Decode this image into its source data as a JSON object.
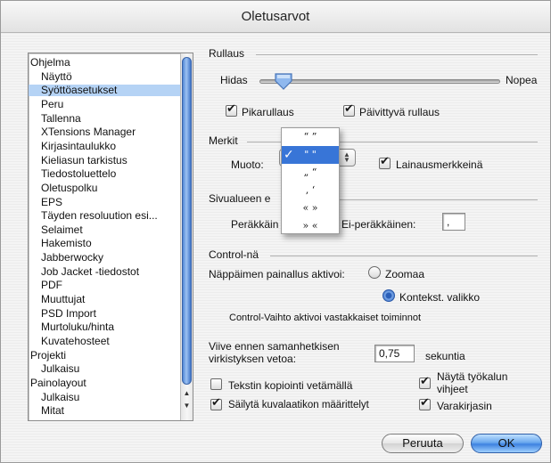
{
  "window": {
    "title": "Oletusarvot"
  },
  "list": {
    "items": [
      {
        "label": "Ohjelma",
        "indent": 0,
        "selected": false
      },
      {
        "label": "Näyttö",
        "indent": 1,
        "selected": false
      },
      {
        "label": "Syöttöasetukset",
        "indent": 1,
        "selected": true
      },
      {
        "label": "Peru",
        "indent": 1,
        "selected": false
      },
      {
        "label": "Tallenna",
        "indent": 1,
        "selected": false
      },
      {
        "label": "XTensions Manager",
        "indent": 1,
        "selected": false
      },
      {
        "label": "Kirjasintaulukko",
        "indent": 1,
        "selected": false
      },
      {
        "label": "Kieliasun tarkistus",
        "indent": 1,
        "selected": false
      },
      {
        "label": "Tiedostoluettelo",
        "indent": 1,
        "selected": false
      },
      {
        "label": "Oletuspolku",
        "indent": 1,
        "selected": false
      },
      {
        "label": "EPS",
        "indent": 1,
        "selected": false
      },
      {
        "label": "Täyden resoluution esi...",
        "indent": 1,
        "selected": false
      },
      {
        "label": "Selaimet",
        "indent": 1,
        "selected": false
      },
      {
        "label": "Hakemisto",
        "indent": 1,
        "selected": false
      },
      {
        "label": "Jabberwocky",
        "indent": 1,
        "selected": false
      },
      {
        "label": "Job Jacket -tiedostot",
        "indent": 1,
        "selected": false
      },
      {
        "label": "PDF",
        "indent": 1,
        "selected": false
      },
      {
        "label": "Muuttujat",
        "indent": 1,
        "selected": false
      },
      {
        "label": "PSD Import",
        "indent": 1,
        "selected": false
      },
      {
        "label": "Murtoluku/hinta",
        "indent": 1,
        "selected": false
      },
      {
        "label": "Kuvatehosteet",
        "indent": 1,
        "selected": false
      },
      {
        "label": "Projekti",
        "indent": 0,
        "selected": false
      },
      {
        "label": "Julkaisu",
        "indent": 1,
        "selected": false
      },
      {
        "label": "Painolayout",
        "indent": 0,
        "selected": false
      },
      {
        "label": "Julkaisu",
        "indent": 1,
        "selected": false
      },
      {
        "label": "Mitat",
        "indent": 1,
        "selected": false
      }
    ]
  },
  "rullaus": {
    "group_label": "Rullaus",
    "slow_label": "Hidas",
    "fast_label": "Nopea",
    "slider_value": 0.1,
    "pikarullaus_label": "Pikarullaus",
    "pikarullaus_checked": true,
    "paivittyva_label": "Päivittyvä rullaus",
    "paivittyva_checked": true
  },
  "merkit": {
    "group_label": "Merkit",
    "muoto_label": "Muoto:",
    "lainausmerkkeina_label": "Lainausmerkkeinä",
    "lainausmerkkeina_checked": true,
    "dropdown_options": [
      "“ ”",
      "\" \"",
      "„ “",
      "‚ ‘",
      "« »",
      "» «"
    ],
    "dropdown_selected_index": 1
  },
  "sivualue": {
    "group_label": "Sivualueen e",
    "perakkain_label": "Peräkkäin",
    "ei_perakkainen_label": "Ei-peräkkäinen:",
    "ei_perakkainen_value": ","
  },
  "control": {
    "group_label": "Control-nä",
    "activate_label": "Näppäimen painallus aktivoi:",
    "zoom_label": "Zoomaa",
    "zoom_checked": false,
    "context_label": "Kontekst. valikko",
    "context_checked": true,
    "note": "Control-Vaihto aktivoi vastakkaiset toiminnot"
  },
  "misc": {
    "delay_label_1": "Viive ennen samanhetkisen",
    "delay_label_2": "virkistyksen vetoa:",
    "delay_value": "0,75",
    "seconds_label": "sekuntia",
    "copy_label": "Tekstin kopiointi vetämällä",
    "copy_checked": false,
    "tooltips_label_1": "Näytä työkalun",
    "tooltips_label_2": "vihjeet",
    "tooltips_checked": true,
    "keep_label": "Säilytä kuvalaatikon määrittelyt",
    "keep_checked": true,
    "backup_label": "Varakirjasin",
    "backup_checked": true
  },
  "buttons": {
    "cancel": "Peruuta",
    "ok": "OK"
  }
}
